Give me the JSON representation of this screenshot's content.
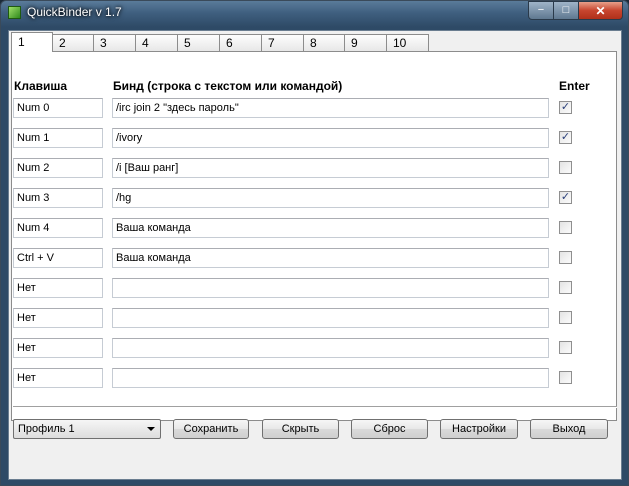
{
  "window": {
    "title": "QuickBinder v 1.7",
    "controls": {
      "minimize": "−",
      "maximize": "□",
      "close": "✕"
    }
  },
  "tabs": [
    "1",
    "2",
    "3",
    "4",
    "5",
    "6",
    "7",
    "8",
    "9",
    "10"
  ],
  "active_tab": "1",
  "headers": {
    "key": "Клавиша",
    "bind": "Бинд (строка с текстом или командой)",
    "enter": "Enter"
  },
  "rows": [
    {
      "key": "Num 0",
      "bind": "/irc join 2 \"здесь пароль\"",
      "enter": true
    },
    {
      "key": "Num 1",
      "bind": "/ivory",
      "enter": true
    },
    {
      "key": "Num 2",
      "bind": "/i [Ваш ранг]",
      "enter": false
    },
    {
      "key": "Num 3",
      "bind": "/hg",
      "enter": true
    },
    {
      "key": "Num 4",
      "bind": "Ваша команда",
      "enter": false
    },
    {
      "key": "Ctrl + V",
      "bind": "Ваша команда",
      "enter": false
    },
    {
      "key": "Нет",
      "bind": "",
      "enter": false
    },
    {
      "key": "Нет",
      "bind": "",
      "enter": false
    },
    {
      "key": "Нет",
      "bind": "",
      "enter": false
    },
    {
      "key": "Нет",
      "bind": "",
      "enter": false
    }
  ],
  "profile": {
    "selected": "Профиль 1"
  },
  "buttons": {
    "save": "Сохранить",
    "hide": "Скрыть",
    "reset": "Сброс",
    "settings": "Настройки",
    "exit": "Выход"
  },
  "colors": {
    "titlebar": "#3f5f7f",
    "close": "#c7452e",
    "check": "#2a3f7a"
  }
}
